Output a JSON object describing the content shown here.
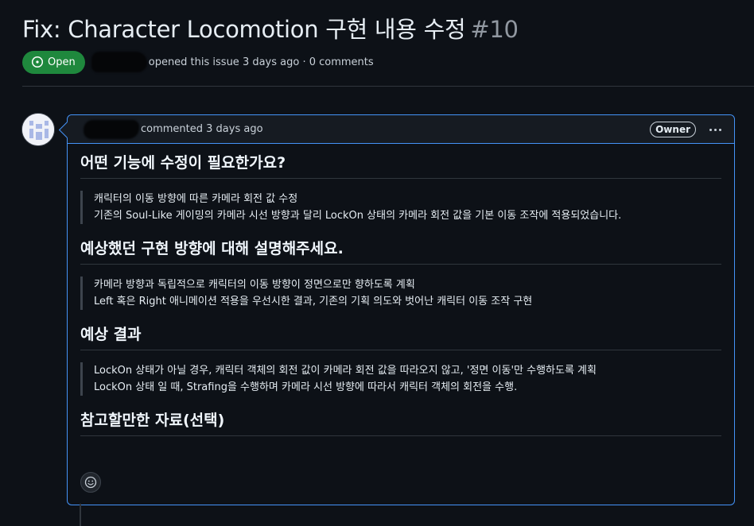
{
  "issue": {
    "title": "Fix: Character Locomotion 구현 내용 수정",
    "number": "#10",
    "state_label": "Open",
    "meta_text": "opened this issue 3 days ago · 0 comments"
  },
  "comment": {
    "header_text": "commented 3 days ago",
    "role_badge": "Owner",
    "sections": [
      {
        "heading": "어떤 기능에 수정이 필요한가요?",
        "lines": [
          "캐릭터의 이동 방향에 따른 카메라 회전 값 수정",
          "기존의 Soul-Like 게이밍의 카메라 시선 방향과 달리 LockOn 상태의 카메라 회전 값을 기본 이동 조작에 적용되었습니다."
        ]
      },
      {
        "heading": "예상했던 구현 방향에 대해 설명해주세요.",
        "lines": [
          "카메라 방향과 독립적으로 캐릭터의 이동 방향이 정면으로만 향하도록 계획",
          "Left 혹은 Right 애니메이션 적용을 우선시한 결과, 기존의 기획 의도와 벗어난 캐릭터 이동 조작 구현"
        ]
      },
      {
        "heading": "예상 결과",
        "lines": [
          "LockOn 상태가 아닐 경우, 캐릭터 객체의 회전 값이 카메라 회전 값을 따라오지 않고, '정면 이동'만 수행하도록 계획",
          "LockOn 상태 일 때, Strafing을 수행하며 카메라 시선 방향에 따라서 캐릭터 객체의 회전을 수행."
        ]
      },
      {
        "heading": "참고할만한 자료(선택)",
        "lines": []
      }
    ]
  },
  "icons": {
    "state": "issue-open-icon",
    "avatar": "identicon-avatar",
    "menu": "kebab-horizontal-icon",
    "reaction": "smiley-icon"
  },
  "colors": {
    "background": "#0d1117",
    "open_badge": "#1f883d",
    "accent_border": "#4493f8",
    "header_bg": "#161b22"
  }
}
